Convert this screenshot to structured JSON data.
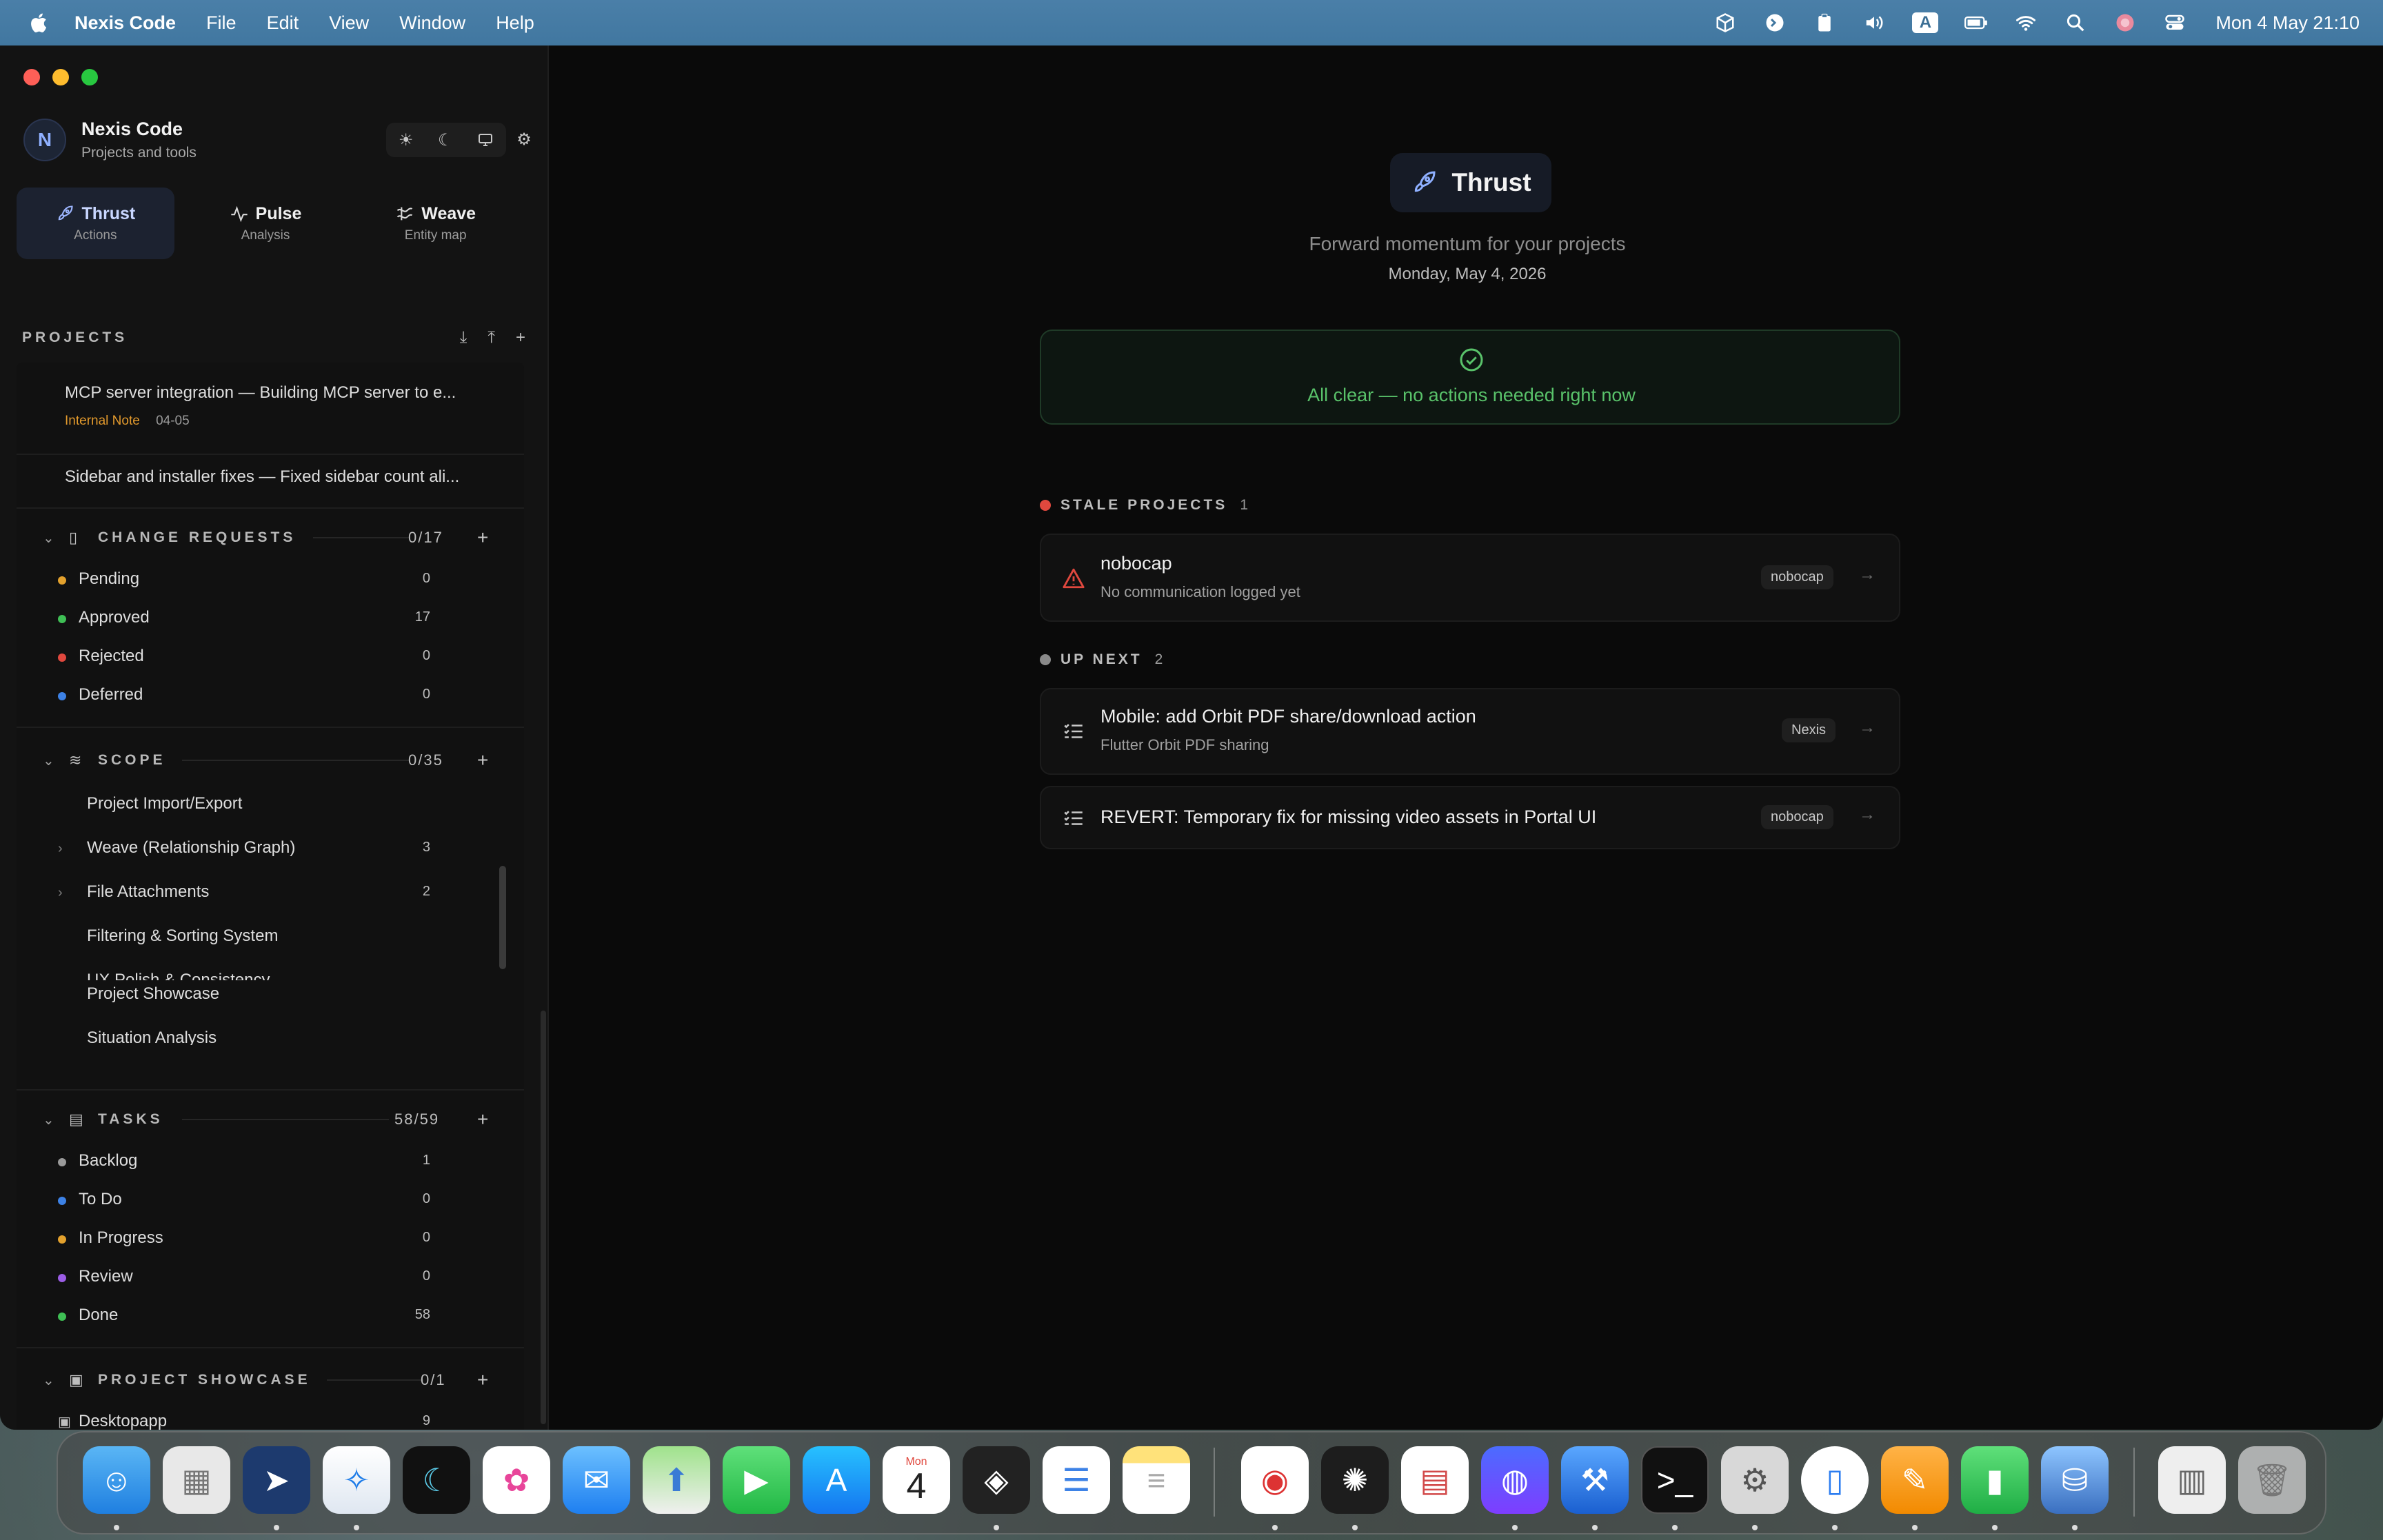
{
  "menubar": {
    "app_name": "Nexis Code",
    "menus": [
      "File",
      "Edit",
      "View",
      "Window",
      "Help"
    ],
    "input_badge": "A",
    "clock": "Mon 4 May  21:10"
  },
  "sidebar": {
    "avatar_initial": "N",
    "app_title": "Nexis Code",
    "app_subtitle": "Projects and tools",
    "tabs": [
      {
        "label": "Thrust",
        "sub": "Actions"
      },
      {
        "label": "Pulse",
        "sub": "Analysis"
      },
      {
        "label": "Weave",
        "sub": "Entity map"
      }
    ],
    "projects_label": "PROJECTS",
    "notes": [
      {
        "title": "MCP server integration — Building MCP server to e...",
        "tag": "Internal Note",
        "date": "04-05"
      },
      {
        "title": "Sidebar and installer fixes — Fixed sidebar count ali..."
      }
    ],
    "change_requests": {
      "label": "CHANGE REQUESTS",
      "count": "0/17",
      "items": [
        {
          "label": "Pending",
          "count": "0",
          "color": "#e3a12d"
        },
        {
          "label": "Approved",
          "count": "17",
          "color": "#3fbf55"
        },
        {
          "label": "Rejected",
          "count": "0",
          "color": "#e0483e"
        },
        {
          "label": "Deferred",
          "count": "0",
          "color": "#3d82e6"
        }
      ]
    },
    "scope": {
      "label": "SCOPE",
      "count": "0/35",
      "items": [
        {
          "label": "Project Import/Export",
          "count": ""
        },
        {
          "label": "Weave (Relationship Graph)",
          "count": "3"
        },
        {
          "label": "File Attachments",
          "count": "2"
        },
        {
          "label": "Filtering & Sorting System",
          "count": ""
        },
        {
          "label": "UX Polish & Consistency",
          "count": ""
        },
        {
          "label": "Project Showcase",
          "count": ""
        },
        {
          "label": "Situation Analysis",
          "count": ""
        }
      ]
    },
    "tasks": {
      "label": "TASKS",
      "count": "58/59",
      "items": [
        {
          "label": "Backlog",
          "count": "1",
          "color": "#9a9a9a"
        },
        {
          "label": "To Do",
          "count": "0",
          "color": "#3d82e6"
        },
        {
          "label": "In Progress",
          "count": "0",
          "color": "#e3a12d"
        },
        {
          "label": "Review",
          "count": "0",
          "color": "#9b5de5"
        },
        {
          "label": "Done",
          "count": "58",
          "color": "#3fbf55"
        }
      ]
    },
    "showcase": {
      "label": "PROJECT SHOWCASE",
      "count": "0/1",
      "items": [
        {
          "label": "Desktopapp",
          "count": "9"
        }
      ]
    }
  },
  "main": {
    "hero_title": "Thrust",
    "hero_subtitle": "Forward momentum for your projects",
    "date": "Monday, May 4, 2026",
    "all_clear": "All clear — no actions needed right now",
    "stale": {
      "label": "STALE PROJECTS",
      "count": "1",
      "items": [
        {
          "title": "nobocap",
          "sub": "No communication logged yet",
          "chip": "nobocap"
        }
      ]
    },
    "upnext": {
      "label": "UP NEXT",
      "count": "2",
      "items": [
        {
          "title": "Mobile: add Orbit PDF share/download action",
          "sub": "Flutter Orbit PDF sharing",
          "chip": "Nexis"
        },
        {
          "title": "REVERT: Temporary fix for missing video assets in Portal UI",
          "chip": "nobocap"
        }
      ]
    }
  },
  "dock": {
    "apps": [
      "finder",
      "launchpad",
      "mail-send",
      "safari",
      "arc",
      "photos",
      "mail",
      "maps",
      "facetime",
      "app-store",
      "calendar",
      "unity",
      "reminders",
      "notes",
      "chrome",
      "chatgpt",
      "numbers-sheet",
      "messenger",
      "xcode",
      "terminal",
      "system-settings",
      "simulator",
      "pages",
      "numbers",
      "disk-utility",
      "archive",
      "trash"
    ],
    "calendar_month": "Mon",
    "calendar_day": "4"
  }
}
